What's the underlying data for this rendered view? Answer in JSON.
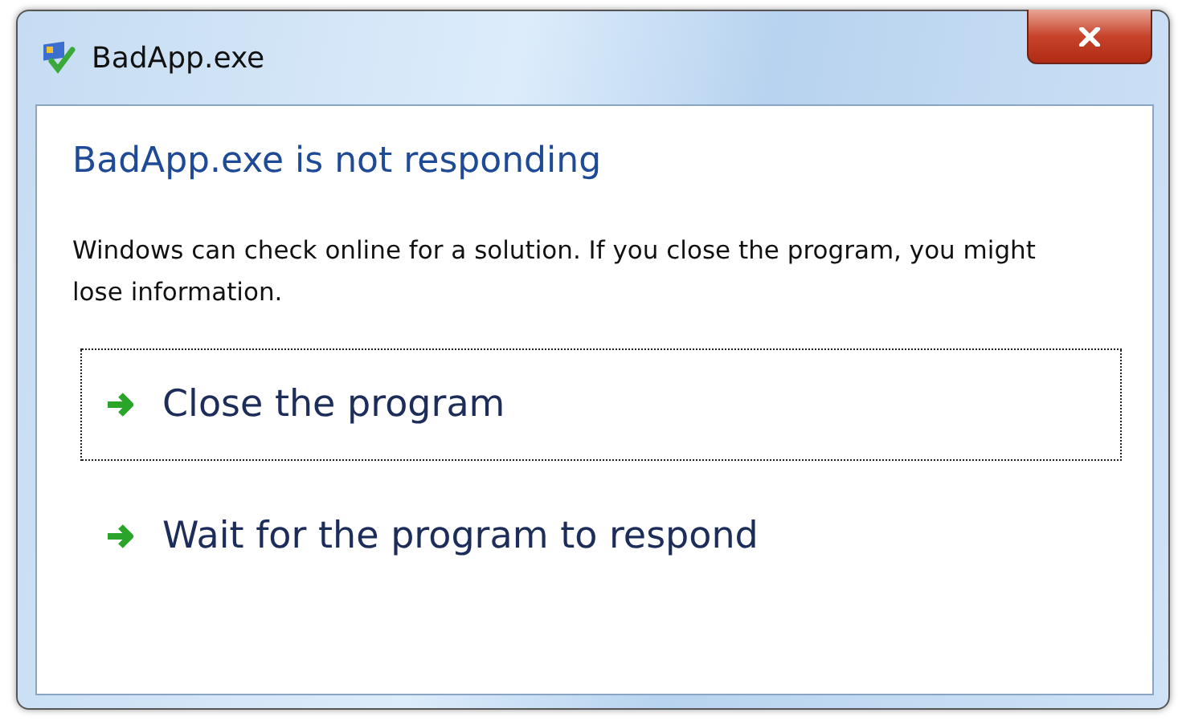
{
  "window": {
    "title": "BadApp.exe"
  },
  "heading": "BadApp.exe is not responding",
  "message": "Windows can check online for a solution. If you close the program, you might lose information.",
  "commands": [
    {
      "label": "Close the program",
      "focused": true
    },
    {
      "label": "Wait for the program to respond",
      "focused": false
    }
  ]
}
